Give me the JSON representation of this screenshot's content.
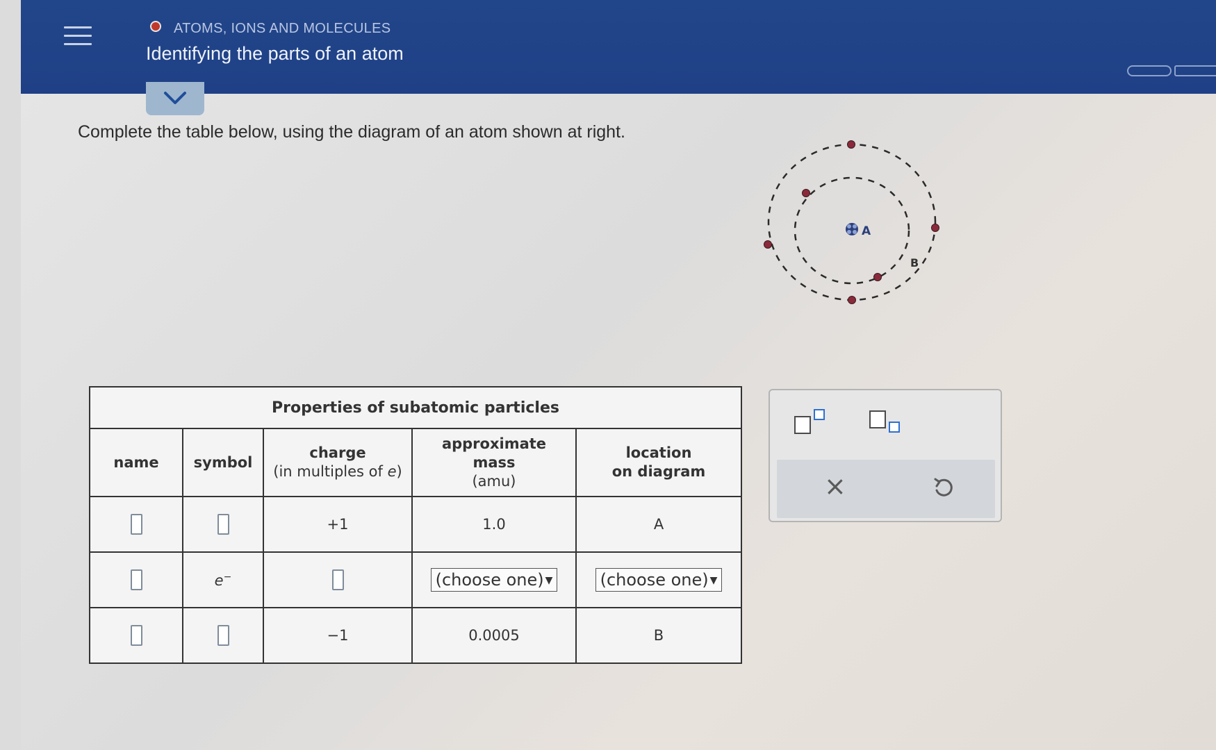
{
  "header": {
    "section": "ATOMS, IONS AND MOLECULES",
    "title": "Identifying the parts of an atom"
  },
  "instruction": "Complete the table below, using the diagram of an atom shown at right.",
  "diagram": {
    "label_nucleus": "A",
    "label_electron": "B"
  },
  "table": {
    "title": "Properties of subatomic particles",
    "headers": {
      "name": "name",
      "symbol": "symbol",
      "charge": "charge",
      "charge_sub_pre": "(in multiples of ",
      "charge_sub_var": "e",
      "charge_sub_post": ")",
      "mass_1": "approximate",
      "mass_2": "mass",
      "mass_sub": "(amu)",
      "location_1": "location",
      "location_2": "on diagram"
    },
    "rows": [
      {
        "charge": "+1",
        "mass": "1.0",
        "location": "A"
      },
      {
        "symbol": "e",
        "symbol_sup": "−",
        "mass_select": "(choose one)",
        "location_select": "(choose one)"
      },
      {
        "charge": "−1",
        "mass": "0.0005",
        "location": "B"
      }
    ]
  },
  "tools": {
    "superscript": "superscript-tool",
    "subscript": "subscript-tool",
    "clear": "×",
    "undo": "undo"
  },
  "colors": {
    "header_bg": "#22468a",
    "status_dot": "#c0392b",
    "electron": "#8b2a3a",
    "nucleus": "#2c3f7a"
  }
}
